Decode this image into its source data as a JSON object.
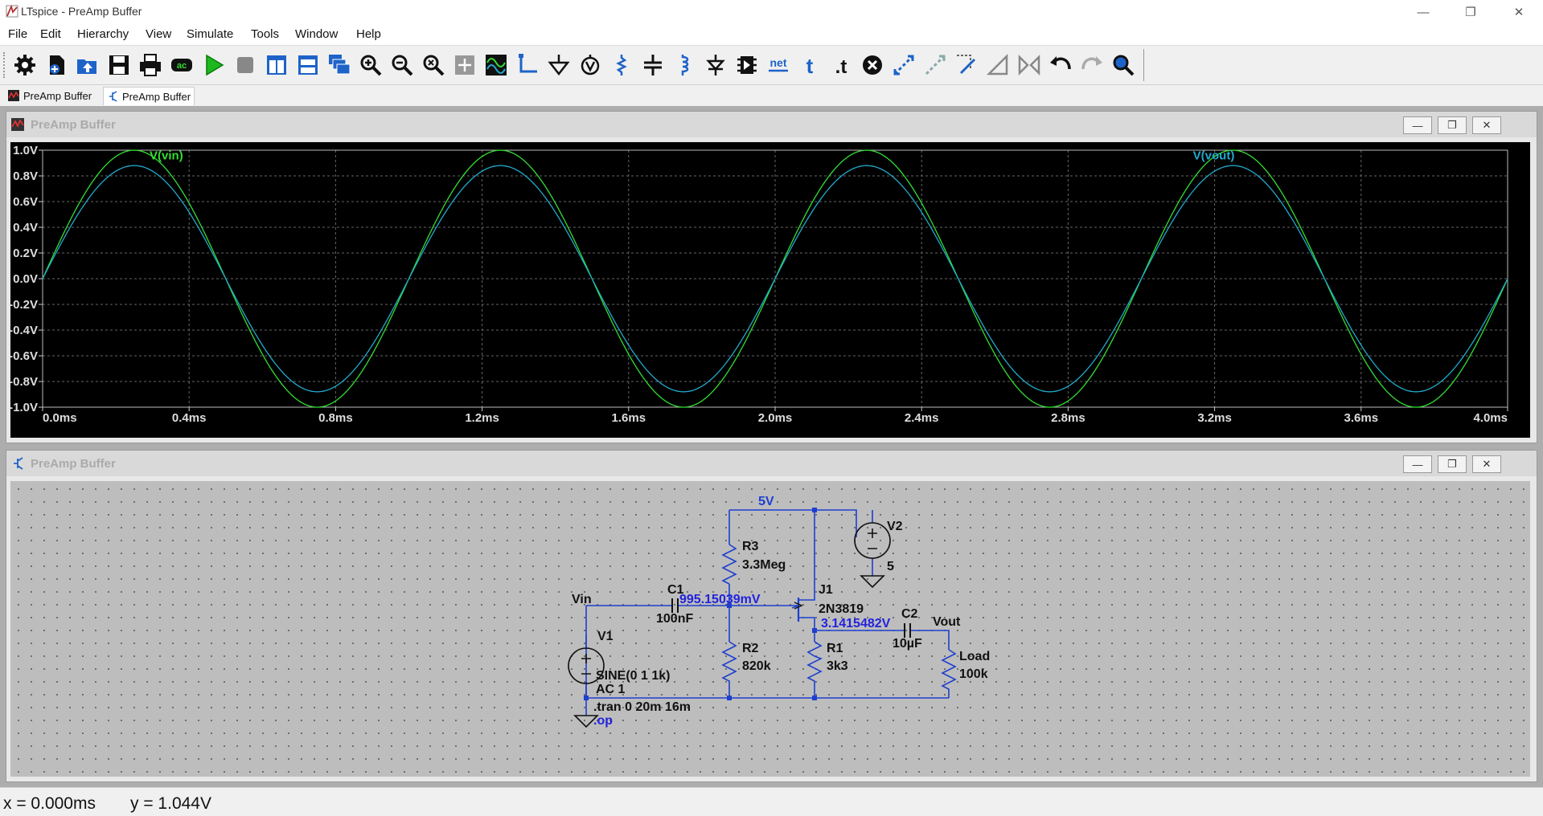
{
  "window": {
    "title": "LTspice - PreAmp Buffer"
  },
  "menu": [
    "File",
    "Edit",
    "Hierarchy",
    "View",
    "Simulate",
    "Tools",
    "Window",
    "Help"
  ],
  "toolbar": {
    "net_label": "net",
    "text_label": "t",
    "spice_directive_label": ".t",
    "ac_label": "ac"
  },
  "tabs": [
    {
      "label": "PreAmp Buffer",
      "icon": "waveform-icon"
    },
    {
      "label": "PreAmp Buffer",
      "icon": "schematic-icon"
    }
  ],
  "plot_window": {
    "title": "PreAmp Buffer"
  },
  "schematic_window": {
    "title": "PreAmp Buffer"
  },
  "chart_data": {
    "type": "line",
    "xlim": [
      0.0,
      4.0
    ],
    "ylim": [
      -1.0,
      1.0
    ],
    "xticks": [
      "0.0ms",
      "0.4ms",
      "0.8ms",
      "1.2ms",
      "1.6ms",
      "2.0ms",
      "2.4ms",
      "2.8ms",
      "3.2ms",
      "3.6ms",
      "4.0ms"
    ],
    "yticks": [
      "1.0V",
      "0.8V",
      "0.6V",
      "0.4V",
      "0.2V",
      "0.0V",
      "-0.2V",
      "-0.4V",
      "-0.6V",
      "-0.8V",
      "-1.0V"
    ],
    "grid": true,
    "series": [
      {
        "name": "V(vin)",
        "color": "#33dd33",
        "amplitude": 1.0,
        "frequency_khz": 1
      },
      {
        "name": "V(vout)",
        "color": "#22aacc",
        "amplitude": 0.88,
        "frequency_khz": 1
      }
    ]
  },
  "schematic": {
    "nets": {
      "supply": "5V",
      "input": "Vin",
      "output": "Vout"
    },
    "components": {
      "R3": {
        "ref": "R3",
        "value": "3.3Meg"
      },
      "R2": {
        "ref": "R2",
        "value": "820k"
      },
      "R1": {
        "ref": "R1",
        "value": "3k3"
      },
      "Load": {
        "ref": "Load",
        "value": "100k"
      },
      "C1": {
        "ref": "C1",
        "value": "100nF"
      },
      "C2": {
        "ref": "C2",
        "value": "10µF"
      },
      "J1": {
        "ref": "J1",
        "value": "2N3819"
      },
      "V1": {
        "ref": "V1",
        "value": "SINE(0 1 1k)",
        "ac": "AC 1"
      },
      "V2": {
        "ref": "V2",
        "value": "5"
      }
    },
    "op_labels": {
      "gate": "995.15039mV",
      "source": "3.1415482V"
    },
    "directives": [
      ".tran 0 20m 16m",
      ".op"
    ]
  },
  "status": {
    "x": "x = 0.000ms",
    "y": "y = 1.044V"
  }
}
